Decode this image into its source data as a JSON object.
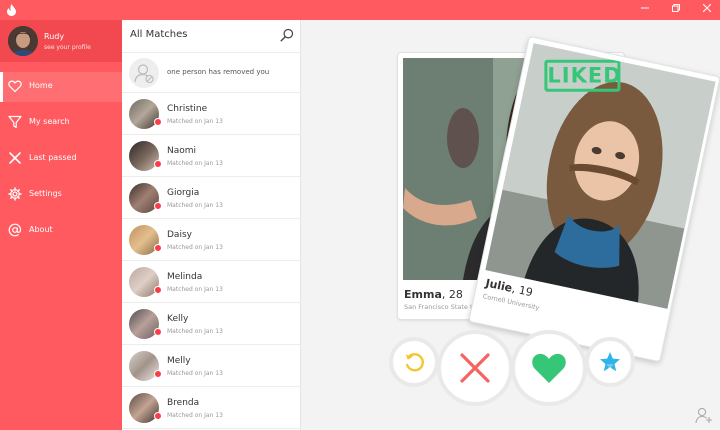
{
  "window": {
    "app_icon": "flame-icon",
    "controls": [
      "minimize-icon",
      "maximize-icon",
      "close-icon"
    ]
  },
  "colors": {
    "brand": "#fe5a5f",
    "like": "#35c777",
    "nope": "#f7645e",
    "rewind": "#f5c431",
    "super": "#2fb3e8"
  },
  "profile": {
    "name": "Rudy",
    "subtitle": "see your profile"
  },
  "nav": [
    {
      "label": "Home",
      "icon": "heart-icon",
      "active": true
    },
    {
      "label": "My search",
      "icon": "filter-icon"
    },
    {
      "label": "Last passed",
      "icon": "x-icon"
    },
    {
      "label": "Settings",
      "icon": "gear-icon"
    },
    {
      "label": "About",
      "icon": "at-icon"
    }
  ],
  "matches": {
    "title": "All Matches",
    "notice": "one person has removed you",
    "items": [
      {
        "name": "Christine",
        "date": "Matched on Jan 13"
      },
      {
        "name": "Naomi",
        "date": "Matched on Jan 13"
      },
      {
        "name": "Giorgia",
        "date": "Matched on Jan 13"
      },
      {
        "name": "Daisy",
        "date": "Matched on Jan 13"
      },
      {
        "name": "Melinda",
        "date": "Matched on Jan 13"
      },
      {
        "name": "Kelly",
        "date": "Matched on Jan 13"
      },
      {
        "name": "Melly",
        "date": "Matched on Jan 13"
      },
      {
        "name": "Brenda",
        "date": "Matched on Jan 13"
      }
    ]
  },
  "cards": {
    "back": {
      "name": "Emma",
      "age": "28",
      "school": "San Francisco State University"
    },
    "front": {
      "name": "Julie",
      "age": "19",
      "school": "Cornell University",
      "stamp": "LIKED"
    }
  },
  "actions": [
    "rewind-icon",
    "x-icon",
    "heart-icon",
    "star-icon"
  ]
}
